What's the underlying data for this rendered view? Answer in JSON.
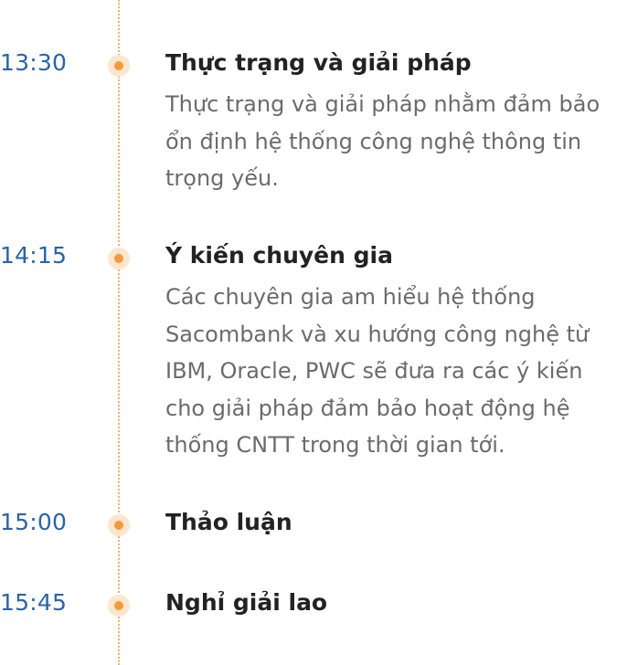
{
  "agenda": [
    {
      "time": "13:30",
      "title": "Thực trạng và giải pháp",
      "description_lines": [
        "Thực trạng và giải pháp nhằm đảm bảo",
        "ổn định hệ thống công nghệ thông tin",
        "trọng yếu."
      ]
    },
    {
      "time": "14:15",
      "title": "Ý kiến chuyên gia",
      "description_lines": [
        "Các chuyên gia am hiểu hệ thống",
        "Sacombank và xu hướng công nghệ từ",
        "IBM, Oracle, PWC sẽ đưa ra các ý kiến",
        "cho giải pháp đảm bảo hoạt động hệ",
        "thống CNTT trong thời gian tới."
      ]
    },
    {
      "time": "15:00",
      "title": "Thảo luận"
    },
    {
      "time": "15:45",
      "title": "Nghỉ giải lao"
    }
  ],
  "colors": {
    "time": "#2a63a8",
    "title": "#222222",
    "description": "#6b6b6b",
    "timeline_dot": "#f59a3c",
    "timeline_line": "#f3b26b"
  }
}
